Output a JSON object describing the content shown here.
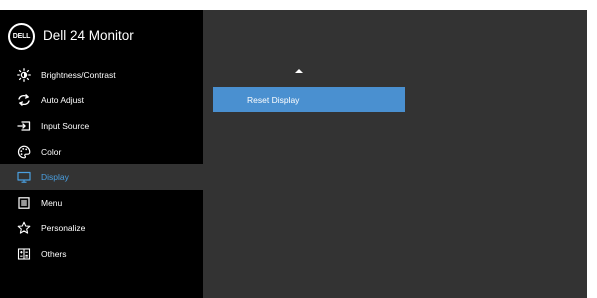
{
  "osd": {
    "logo_text": "DELL",
    "title": "Dell 24 Monitor"
  },
  "menu": {
    "items": [
      {
        "label": "Brightness/Contrast",
        "icon": "brightness-icon",
        "active": false
      },
      {
        "label": "Auto Adjust",
        "icon": "auto-adjust-icon",
        "active": false
      },
      {
        "label": "Input Source",
        "icon": "input-source-icon",
        "active": false
      },
      {
        "label": "Color",
        "icon": "color-icon",
        "active": false
      },
      {
        "label": "Display",
        "icon": "display-icon",
        "active": true
      },
      {
        "label": "Menu",
        "icon": "menu-icon",
        "active": false
      },
      {
        "label": "Personalize",
        "icon": "star-icon",
        "active": false
      },
      {
        "label": "Others",
        "icon": "others-icon",
        "active": false
      }
    ]
  },
  "submenu": {
    "options": [
      {
        "label": "Reset Display",
        "selected": true
      }
    ]
  },
  "colors": {
    "sidebar_bg": "#000000",
    "content_bg": "#333333",
    "active_item_bg": "#333333",
    "active_text": "#4a9fe0",
    "selected_option_bg": "#4a90d0"
  }
}
